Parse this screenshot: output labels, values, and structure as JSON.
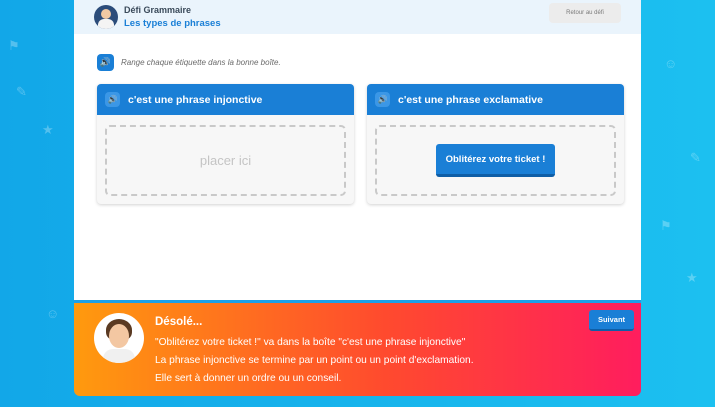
{
  "header": {
    "app_title": "Défi Grammaire",
    "subtitle": "Les types de phrases",
    "back_label": "Retour au défi"
  },
  "instruction": "Range chaque étiquette dans la bonne boîte.",
  "boxes": [
    {
      "title": "c'est une phrase injonctive",
      "placeholder": "placer ici"
    },
    {
      "title": "c'est une phrase exclamative",
      "item": "Oblitérez votre ticket !"
    }
  ],
  "feedback": {
    "title": "Désolé...",
    "lines": [
      "\"Oblitérez votre ticket !\" va dans la boîte \"c'est une phrase injonctive\"",
      "La phrase injonctive se termine par un point ou un point d'exclamation.",
      "Elle sert à donner un ordre ou un conseil."
    ],
    "next_label": "Suivant"
  },
  "icons": {
    "speaker": "speaker-icon",
    "background": [
      "star-icon",
      "pencil-icon",
      "smiley-icon",
      "flag-icon"
    ]
  },
  "colors": {
    "accent": "#1a7fd6",
    "background": "#1cb6ee",
    "feedback_start": "#ff9a0e",
    "feedback_end": "#ff1d5e"
  }
}
